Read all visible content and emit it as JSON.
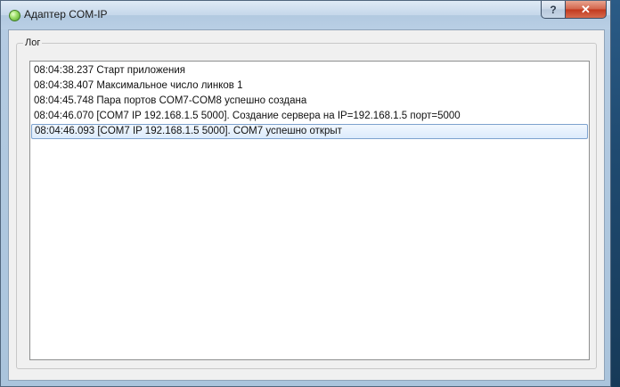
{
  "window": {
    "title": "Адаптер COM-IP",
    "help_label": "?",
    "close_label": "✕"
  },
  "log_group": {
    "label": "Лог",
    "entries": [
      "08:04:38.237 Старт приложения",
      "08:04:38.407 Максимальное число линков 1",
      "08:04:45.748 Пара портов COM7-COM8 успешно создана",
      "08:04:46.070 [COM7 IP 192.168.1.5 5000]. Создание сервера на IP=192.168.1.5 порт=5000",
      "08:04:46.093 [COM7 IP 192.168.1.5 5000]. COM7 успешно открыт"
    ],
    "selected_index": 4
  }
}
